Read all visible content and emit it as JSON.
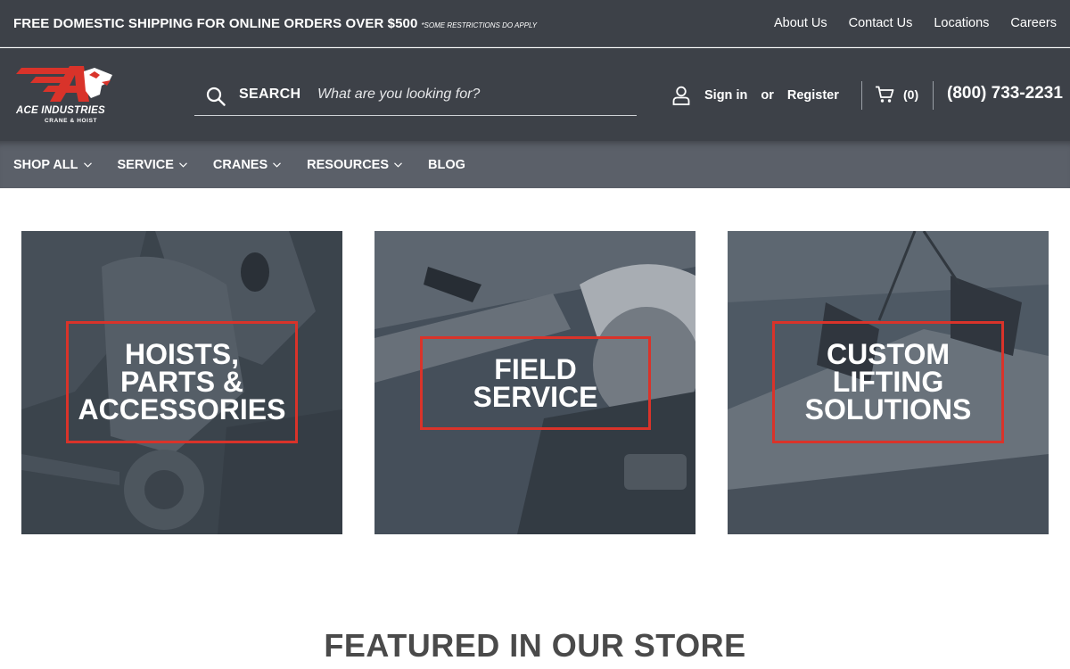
{
  "topbar": {
    "promo": "FREE DOMESTIC SHIPPING FOR ONLINE ORDERS OVER $500",
    "promo_note": "*SOME RESTRICTIONS DO APPLY",
    "links": [
      "About Us",
      "Contact Us",
      "Locations",
      "Careers"
    ]
  },
  "header": {
    "logo_text": "ACE INDUSTRIES",
    "logo_sub": "CRANE & HOIST",
    "search_label": "SEARCH",
    "search_placeholder": "What are you looking for?",
    "sign_in": "Sign in",
    "or": "or",
    "register": "Register",
    "cart_count": "(0)",
    "phone": "(800) 733-2231"
  },
  "nav": {
    "items": [
      {
        "label": "SHOP ALL",
        "dropdown": true
      },
      {
        "label": "SERVICE",
        "dropdown": true
      },
      {
        "label": "CRANES",
        "dropdown": true
      },
      {
        "label": "RESOURCES",
        "dropdown": true
      },
      {
        "label": "BLOG",
        "dropdown": false
      }
    ]
  },
  "tiles": [
    {
      "title": "HOISTS,\nPARTS &\nACCESSORIES"
    },
    {
      "title": "FIELD\nSERVICE"
    },
    {
      "title": "CUSTOM\nLIFTING\nSOLUTIONS"
    }
  ],
  "featured_heading": "FEATURED IN OUR STORE",
  "colors": {
    "header_bg": "#3d4148",
    "nav_bg": "#5b6069",
    "accent_red": "#d9332a",
    "tile_overlay": "#3f4a55"
  },
  "icons": [
    "logo-mark",
    "search-icon",
    "user-icon",
    "cart-icon",
    "chevron-down-icon"
  ]
}
